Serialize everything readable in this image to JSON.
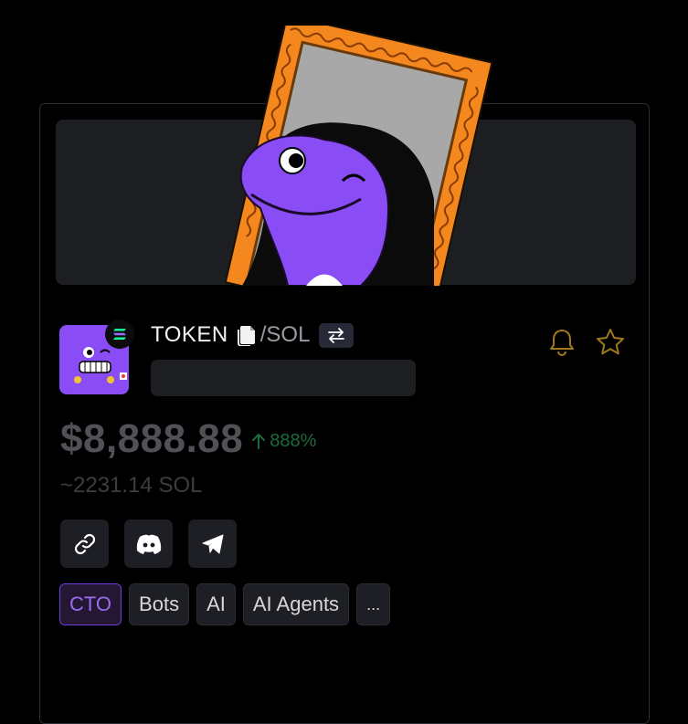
{
  "token": {
    "symbol": "TOKEN",
    "quote": "/SOL",
    "price_usd": "$8,888.88",
    "change_pct": "888%",
    "price_sol": "~2231.14 SOL"
  },
  "icons": {
    "copy": "document-copy-icon",
    "swap": "swap-arrows-icon",
    "alert": "bell-icon",
    "favorite": "star-icon",
    "change": "arrow-up-icon",
    "chain": "solana-icon",
    "socials": [
      "link-icon",
      "discord-icon",
      "telegram-icon"
    ]
  },
  "tags": [
    {
      "label": "CTO"
    },
    {
      "label": "Bots"
    },
    {
      "label": "AI"
    },
    {
      "label": "AI Agents"
    },
    {
      "label": "..."
    }
  ],
  "colors": {
    "accent_purple": "#8a4cf5",
    "frame_orange": "#f5871f",
    "positive_green": "#1d6b3a",
    "alert_gold": "#a07a1e"
  }
}
